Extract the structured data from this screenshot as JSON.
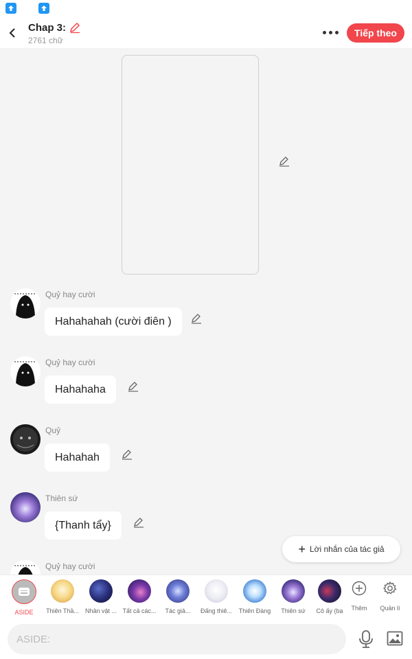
{
  "header": {
    "title": "Chap 3:",
    "word_count": "2761 chữ",
    "next_label": "Tiếp theo"
  },
  "messages": [
    {
      "name": "Quỷ hay cười",
      "text": "Hahahahah (cười điên )"
    },
    {
      "name": "Quỷ hay cười",
      "text": "Hahahaha"
    },
    {
      "name": "Quỷ",
      "text": "Hahahah"
    },
    {
      "name": "Thiên sứ",
      "text": "{Thanh tẩy}"
    },
    {
      "name": "Quỷ hay cười"
    }
  ],
  "author_note_label": "Lời nhắn của tác giả",
  "characters": [
    {
      "label": "ASIDE"
    },
    {
      "label": "Thiên Thầ..."
    },
    {
      "label": "Nhân vật ..."
    },
    {
      "label": "Tất cả các..."
    },
    {
      "label": "Tác giả..."
    },
    {
      "label": "Đấng thiê..."
    },
    {
      "label": "Thiên Đàng"
    },
    {
      "label": "Thiên sứ"
    },
    {
      "label": "Cô ấy (bạ"
    }
  ],
  "tools": {
    "add_label": "Thêm",
    "manage_label": "Quản lí"
  },
  "input": {
    "placeholder": "ASIDE:"
  },
  "colors": {
    "accent": "#f0464c",
    "background": "#f4f4f4",
    "bubble": "#ffffff"
  },
  "icons": [
    "back-arrow-icon",
    "pencil-icon",
    "more-dots-icon",
    "plus-icon",
    "settings-gear-icon",
    "microphone-icon",
    "image-icon"
  ]
}
